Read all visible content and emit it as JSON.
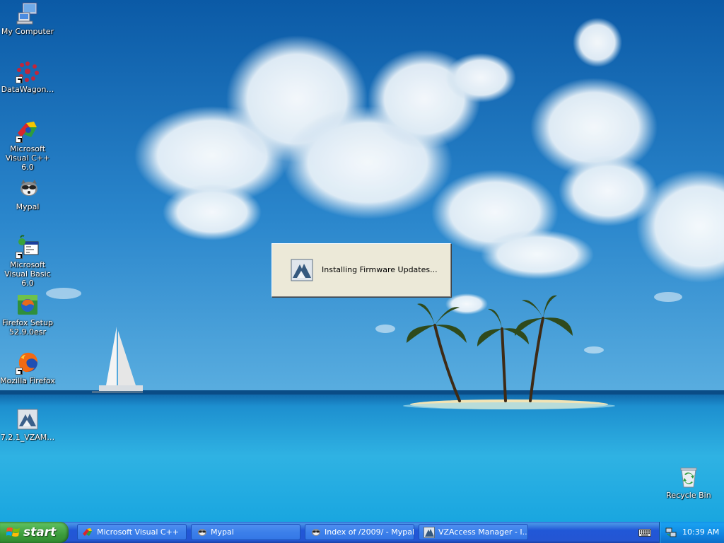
{
  "desktop": {
    "icons": [
      {
        "label": "My Computer",
        "icon": "my-computer-icon"
      },
      {
        "label": "DataWagon…",
        "icon": "datawagon-icon"
      },
      {
        "label": "Microsoft Visual C++ 6.0",
        "icon": "visual-cpp-icon"
      },
      {
        "label": "Mypal",
        "icon": "mypal-icon"
      },
      {
        "label": "Microsoft Visual Basic 6.0",
        "icon": "visual-basic-icon"
      },
      {
        "label": "Firefox Setup 52.9.0esr",
        "icon": "firefox-setup-icon"
      },
      {
        "label": "Mozilla Firefox",
        "icon": "firefox-icon"
      },
      {
        "label": "7.2.1_VZAM…",
        "icon": "vzam-installer-icon"
      },
      {
        "label": "Recycle Bin",
        "icon": "recycle-bin-icon"
      }
    ]
  },
  "dialog": {
    "message": "Installing Firmware Updates...",
    "icon": "vzaccess-icon"
  },
  "taskbar": {
    "start_label": "start",
    "tasks": [
      {
        "label": "Microsoft Visual C++",
        "icon": "visual-cpp-icon"
      },
      {
        "label": "Mypal",
        "icon": "mypal-icon"
      },
      {
        "label": "Index of /2009/ - Mypal",
        "icon": "mypal-icon"
      },
      {
        "label": "VZAccess Manager - I...",
        "icon": "vzaccess-icon"
      }
    ],
    "tray": {
      "clock": "10:39 AM",
      "icons": [
        "keyboard-icon",
        "network-icon"
      ]
    }
  },
  "colors": {
    "taskbar_blue": "#2456d3",
    "start_green": "#3c9d3c",
    "tray_blue": "#0f86e2",
    "dialog_face": "#ece9d8"
  }
}
